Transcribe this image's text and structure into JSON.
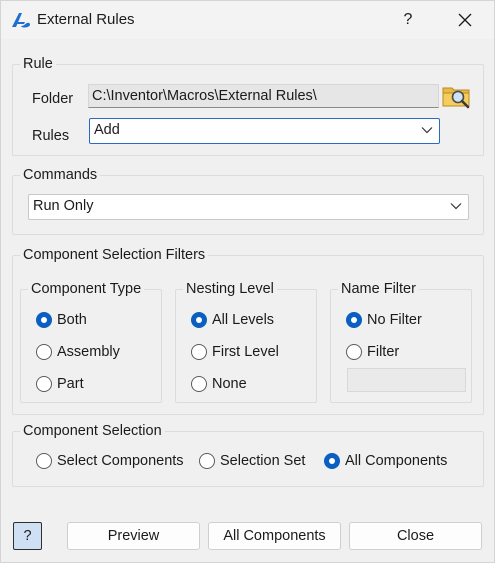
{
  "window": {
    "title": "External Rules",
    "help_glyph": "?",
    "close_icon": "close-icon",
    "app_icon": "autodesk-inventor-icon"
  },
  "rule": {
    "legend": "Rule",
    "folder_label": "Folder",
    "folder_path": "C:\\Inventor\\Macros\\External Rules\\",
    "folder_icon": "folder-search-icon",
    "rules_label": "Rules",
    "rules_value": "Add"
  },
  "commands": {
    "legend": "Commands",
    "value": "Run Only"
  },
  "filters": {
    "legend": "Component Selection Filters",
    "component_type": {
      "legend": "Component Type",
      "options": [
        "Both",
        "Assembly",
        "Part"
      ],
      "selected": "Both"
    },
    "nesting_level": {
      "legend": "Nesting Level",
      "options": [
        "All Levels",
        "First Level",
        "None"
      ],
      "selected": "All Levels"
    },
    "name_filter": {
      "legend": "Name Filter",
      "options": [
        "No Filter",
        "Filter"
      ],
      "selected": "No Filter",
      "filter_text": ""
    }
  },
  "selection": {
    "legend": "Component Selection",
    "options": [
      "Select Components",
      "Selection Set",
      "All Components"
    ],
    "selected": "All Components"
  },
  "buttons": {
    "help": "?",
    "preview": "Preview",
    "all_components": "All Components",
    "close": "Close"
  },
  "colors": {
    "accent": "#0a5fc0",
    "focus_border": "#2a6ac4",
    "help_button_bg": "#cfe0f5",
    "window_bg": "#f0f0f0"
  }
}
